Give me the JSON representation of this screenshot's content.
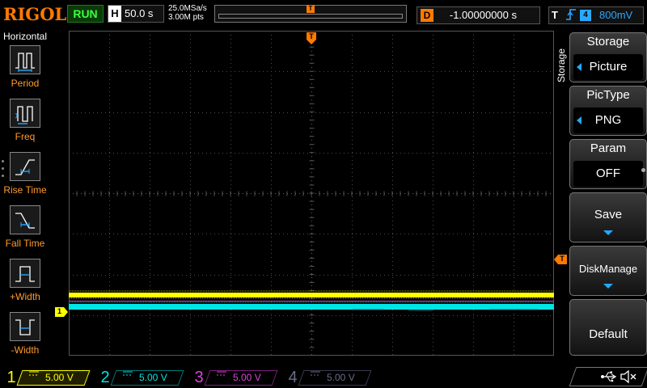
{
  "topbar": {
    "logo": "RIGOL",
    "run_status": "RUN",
    "horizontal_letter": "H",
    "horizontal_timebase": "50.0 s",
    "sample_rate": "25.0MSa/s",
    "memory_depth": "3.00M pts",
    "trigger_marker": "T",
    "delay_letter": "D",
    "delay_value": "-1.00000000 s",
    "trigger_letter": "T",
    "trigger_edge_icon": "rising-edge-icon",
    "trigger_source": "4",
    "trigger_level": "800mV"
  },
  "left_panel": {
    "title": "Horizontal",
    "measurements": [
      {
        "label": "Period",
        "icon": "period-icon"
      },
      {
        "label": "Freq",
        "icon": "frequency-icon"
      },
      {
        "label": "Rise Time",
        "icon": "rise-time-icon"
      },
      {
        "label": "Fall Time",
        "icon": "fall-time-icon"
      },
      {
        "label": "+Width",
        "icon": "positive-width-icon"
      },
      {
        "label": "-Width",
        "icon": "negative-width-icon"
      }
    ]
  },
  "right_menu": {
    "title": "Storage",
    "buttons": [
      {
        "title": "Storage",
        "value": "Picture"
      },
      {
        "title": "PicType",
        "value": "PNG"
      },
      {
        "title": "Param",
        "value": "OFF"
      },
      {
        "label": "Save"
      },
      {
        "label": "DiskManage"
      },
      {
        "label": "Default"
      }
    ]
  },
  "markers": {
    "trigger_position": "T",
    "trigger_level": "T",
    "ch1_ground": "1"
  },
  "channels": [
    {
      "number": "1",
      "coupling_icon": "dc-coupling-icon",
      "scale": "5.00 V",
      "color": "#ffff00"
    },
    {
      "number": "2",
      "coupling_icon": "dc-coupling-icon",
      "scale": "5.00 V",
      "color": "#00e5e5"
    },
    {
      "number": "3",
      "coupling_icon": "dc-coupling-icon",
      "scale": "5.00 V",
      "color": "#e040e0"
    },
    {
      "number": "4",
      "coupling_icon": "dc-coupling-icon",
      "scale": "5.00 V",
      "color": "#6a6a8a"
    }
  ],
  "colors": {
    "accent_orange": "#ff7a00",
    "trigger_blue": "#2aa8ff",
    "run_green": "#3bff3b",
    "ch1_yellow": "#ffff00",
    "ch2_cyan": "#00e5e5"
  },
  "status_icons": [
    "usb-icon",
    "speaker-muted-icon"
  ]
}
